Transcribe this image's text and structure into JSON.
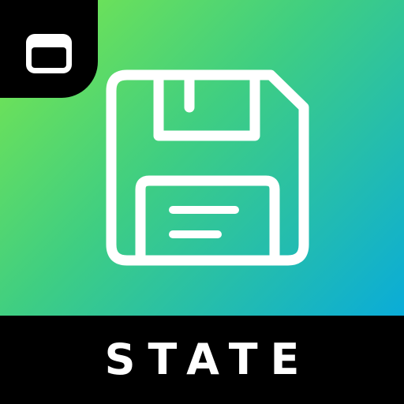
{
  "app": {
    "label": "STATE"
  },
  "icons": {
    "badge": "browser-window-icon",
    "main": "floppy-disk-save-icon"
  },
  "colors": {
    "gradient_start": "#7de84a",
    "gradient_mid": "#3fce82",
    "gradient_end": "#0aacd8",
    "glyph": "#ffffff",
    "background": "#000000"
  }
}
